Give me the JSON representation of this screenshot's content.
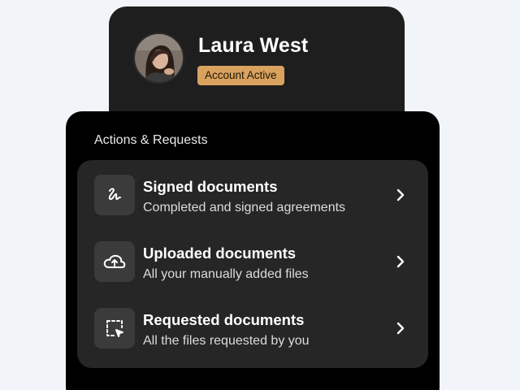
{
  "profile": {
    "name": "Laura West",
    "status": "Account Active",
    "status_color": "#d9a25e"
  },
  "actions": {
    "title": "Actions & Requests",
    "items": [
      {
        "title": "Signed documents",
        "subtitle": "Completed and signed agreements",
        "icon": "signature-icon"
      },
      {
        "title": "Uploaded documents",
        "subtitle": "All your manually added files",
        "icon": "cloud-upload-icon"
      },
      {
        "title": "Requested documents",
        "subtitle": "All the files requested by you",
        "icon": "selection-cursor-icon"
      }
    ]
  },
  "colors": {
    "background": "#f1f4f8",
    "card": "#1f1e1f",
    "panel": "#000000",
    "list": "#262626",
    "icon_tile": "#3b3b3b"
  }
}
